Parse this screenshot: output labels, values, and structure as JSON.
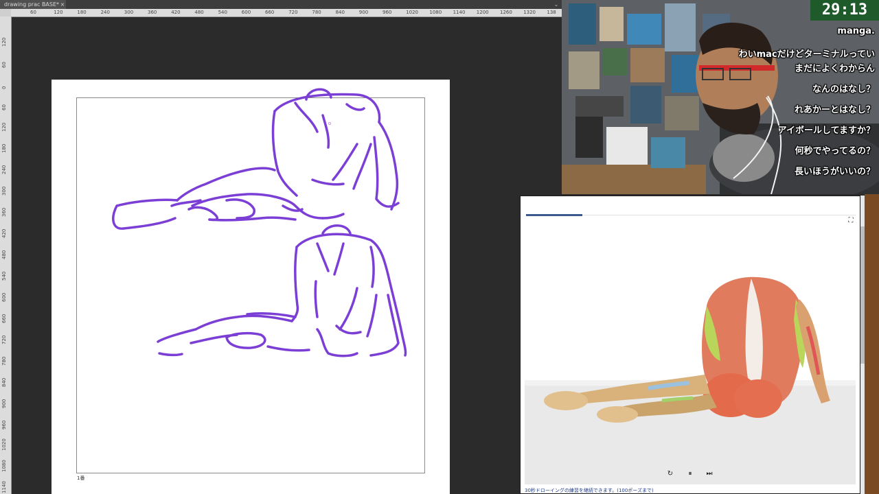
{
  "app": {
    "tab_title": "drawing prac BASE*",
    "tab_close": "×",
    "panel_chevron": "⌄",
    "page_label": "1番"
  },
  "ruler": {
    "horizontal_ticks": [
      "60",
      "120",
      "180",
      "240",
      "300",
      "360",
      "420",
      "480",
      "540",
      "600",
      "660",
      "720",
      "780",
      "840",
      "900",
      "960",
      "1020",
      "1080",
      "1140",
      "1200",
      "1260",
      "1320",
      "138"
    ],
    "vertical_ticks": [
      "120",
      "60",
      "0",
      "60",
      "120",
      "180",
      "240",
      "300",
      "360",
      "420",
      "480",
      "540",
      "600",
      "660",
      "720",
      "780",
      "840",
      "900",
      "960",
      "1020",
      "1080",
      "1140"
    ]
  },
  "stream": {
    "timer": "29:13",
    "comments": [
      "manga.",
      "わいmacだけどターミナルってい",
      "まだによくわからん",
      "なんのはなし？",
      "れあかーとはなし？",
      "アイボールしてますか？",
      "何秒でやってるの？",
      "長いほうがいいの？"
    ]
  },
  "viewer": {
    "fullscreen_icon": "⛶",
    "replay_icon": "↻",
    "pause_icon": "⏸",
    "next_icon": "⏭",
    "footer_text": "30秒ドローイングの練習を継続できます。(100ポーズまで)",
    "progress_fraction": 0.17
  },
  "colors": {
    "sketch_stroke": "#7b3fd6",
    "accent": "#3a5a8c"
  }
}
